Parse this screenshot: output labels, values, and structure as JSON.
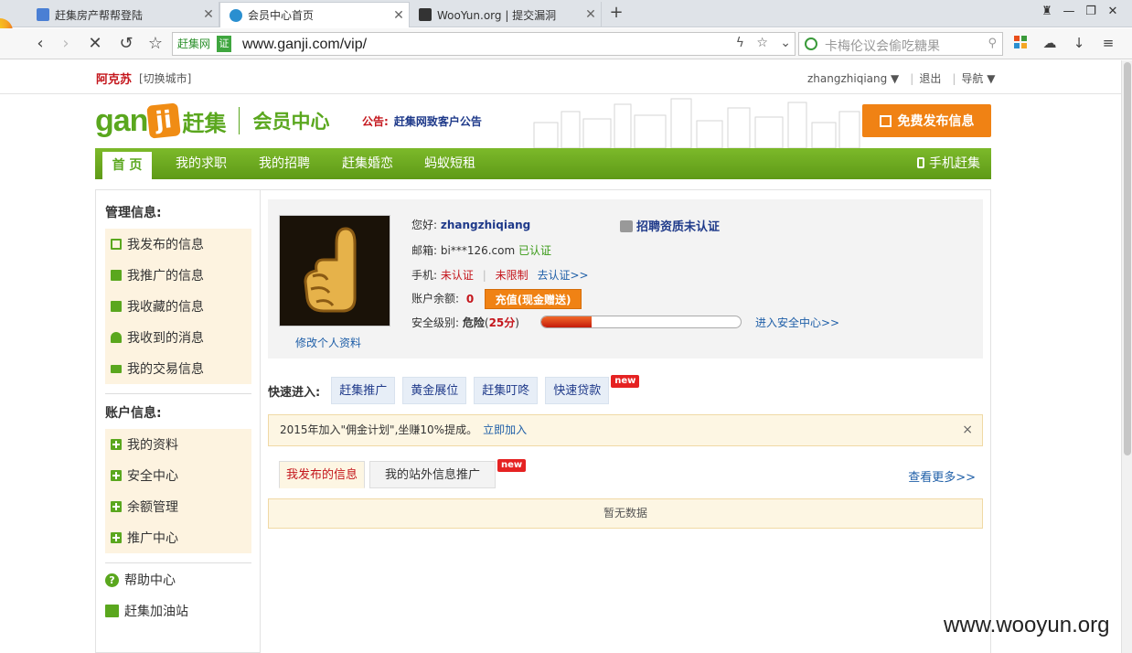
{
  "browser": {
    "tabs": [
      {
        "title": "赶集房产帮帮登陆",
        "favicon_color": "#4a7fd4"
      },
      {
        "title": "会员中心首页",
        "favicon_color": "#2a8fd0"
      },
      {
        "title": "WooYun.org | 提交漏洞",
        "favicon_color": "#333333"
      }
    ],
    "new_tab": "+",
    "site_tag": "赶集网",
    "cert_mark": "证",
    "url": "www.ganji.com/vip/",
    "search_placeholder": "卡梅伦议会偷吃糖果"
  },
  "topbar": {
    "city": "阿克苏",
    "switch_city": "[切换城市]",
    "username": "zhangzhiqiang ▼",
    "logout": "退出",
    "nav": "导航 ▼"
  },
  "header": {
    "logo_gan": "gan",
    "logo_ji": "ji",
    "logo_cn": "赶集",
    "member_center": "会员中心",
    "notice_label": "公告:",
    "notice_link": "赶集网致客户公告",
    "publish_button": "免费发布信息"
  },
  "mainnav": {
    "items": [
      "首 页",
      "我的求职",
      "我的招聘",
      "赶集婚恋",
      "蚂蚁短租"
    ],
    "mobile": "手机赶集"
  },
  "sidebar": {
    "manage_title": "管理信息:",
    "manage_items": [
      "我发布的信息",
      "我推广的信息",
      "我收藏的信息",
      "我收到的消息",
      "我的交易信息"
    ],
    "account_title": "账户信息:",
    "account_items": [
      "我的资料",
      "安全中心",
      "余额管理",
      "推广中心"
    ],
    "help_items": [
      "帮助中心",
      "赶集加油站"
    ]
  },
  "profile": {
    "edit_profile": "修改个人资料",
    "greeting_label": "您好:",
    "username": "zhangzhiqiang",
    "email_label": "邮箱:",
    "email": "bi***126.com",
    "email_status": "已认证",
    "phone_label": "手机:",
    "phone_status": "未认证",
    "phone_limit": "未限制",
    "phone_verify": "去认证>>",
    "balance_label": "账户余额:",
    "balance": "0",
    "recharge_button": "充值(现金赠送)",
    "security_label": "安全级别:",
    "security_level": "危险",
    "security_score_open": "(",
    "security_score": "25分",
    "security_score_close": ")",
    "security_fraction": 0.25,
    "security_center_link": "进入安全中心>>",
    "cert_status": "招聘资质未认证"
  },
  "quick": {
    "label": "快速进入:",
    "buttons": [
      "赶集推广",
      "黄金展位",
      "赶集叮咚",
      "快速贷款"
    ],
    "new_badge": "new"
  },
  "banner": {
    "text": "2015年加入\"佣金计划\",坐赚10%提成。",
    "join": "立即加入",
    "close": "×"
  },
  "tabs": {
    "items": [
      "我发布的信息",
      "我的站外信息推广"
    ],
    "new_badge": "new",
    "more": "查看更多>>",
    "empty": "暂无数据"
  },
  "watermark": "www.wooyun.org"
}
